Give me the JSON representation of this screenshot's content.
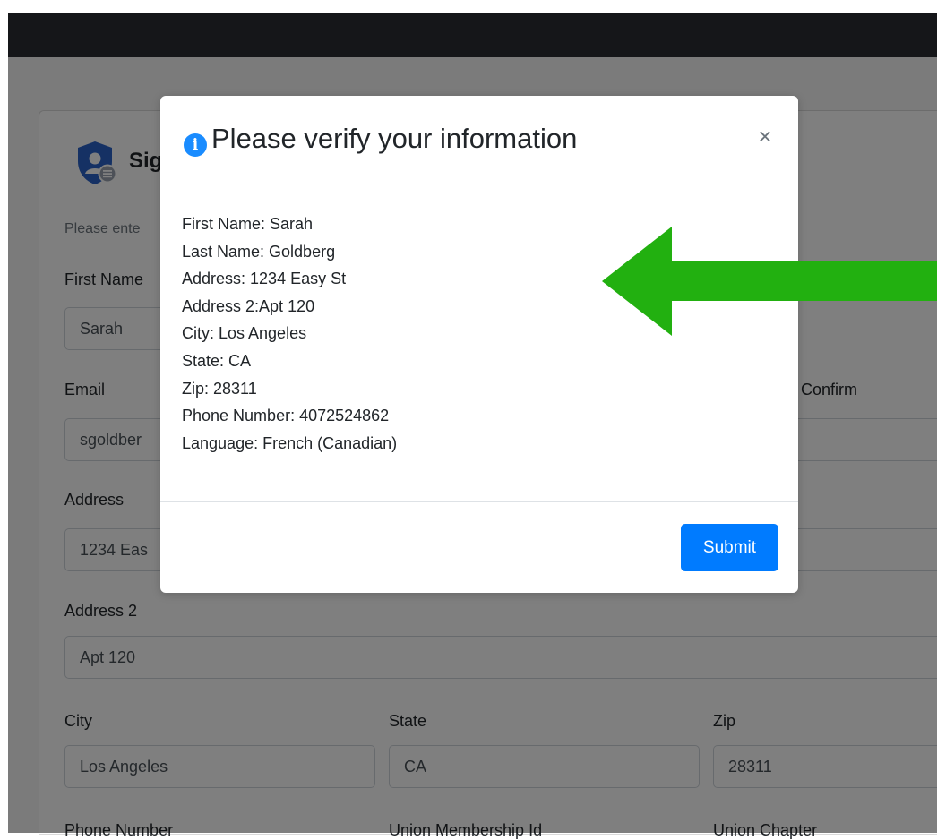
{
  "colors": {
    "topbar": "#2a2d33",
    "accent": "#007bff",
    "info_icon": "#1a8cff",
    "arrow": "#22b010"
  },
  "form": {
    "title": "Sig",
    "subtitle": "Please ente",
    "first_name_label": "First Name",
    "first_name_value": "Sarah",
    "email_label": "Email",
    "email_value": "sgoldber",
    "confirm_label": "Confirm",
    "confirm_value": "•",
    "address_label": "Address",
    "address_value": "1234 Eas",
    "address2_label": "Address 2",
    "address2_value": "Apt 120",
    "city_label": "City",
    "city_value": "Los Angeles",
    "state_label": "State",
    "state_value": "CA",
    "zip_label": "Zip",
    "zip_value": "28311",
    "phone_label": "Phone Number",
    "union_id_label": "Union Membership Id",
    "union_chapter_label": "Union Chapter"
  },
  "modal": {
    "icon": "info-icon",
    "icon_glyph": "i",
    "title": "Please verify your information",
    "close_glyph": "×",
    "lines": [
      "First Name: Sarah",
      "Last Name: Goldberg",
      "Address: 1234 Easy St",
      "Address 2:Apt 120",
      "City: Los Angeles",
      "State: CA",
      "Zip: 28311",
      "Phone Number: 4072524862",
      "Language: French (Canadian)"
    ],
    "submit_label": "Submit"
  },
  "annotation": {
    "icon": "left-arrow-icon"
  }
}
